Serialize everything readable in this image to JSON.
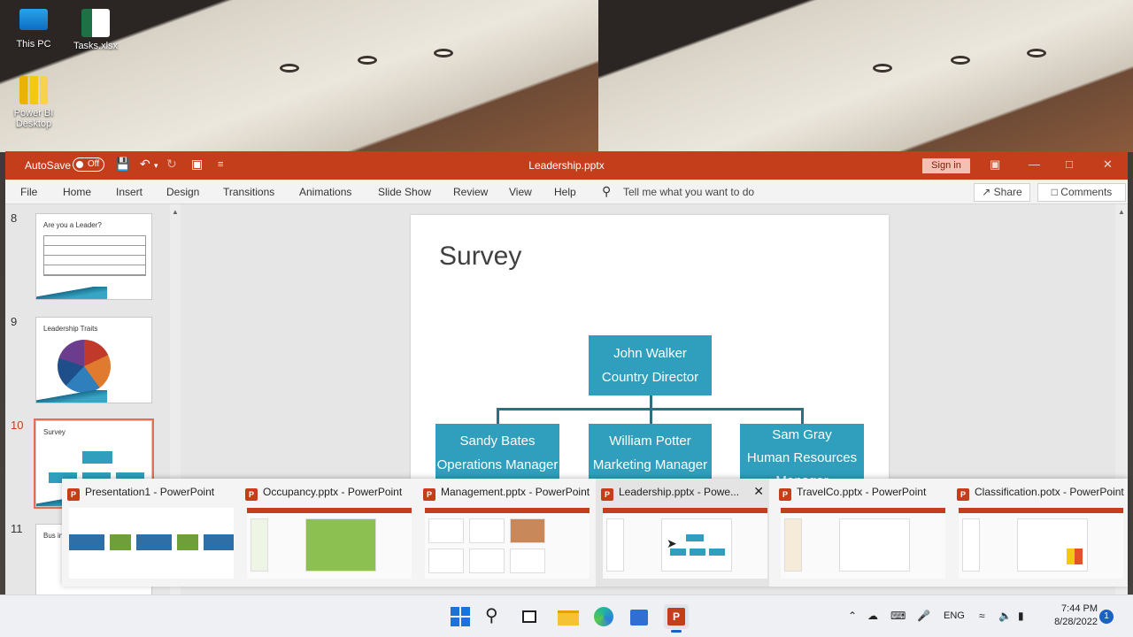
{
  "desktop": {
    "icons": [
      {
        "label": "This PC"
      },
      {
        "label": "Tasks.xlsx"
      },
      {
        "label": "Power BI Desktop"
      }
    ]
  },
  "window": {
    "title": "Leadership.pptx",
    "autosave_label": "AutoSave",
    "autosave_state": "Off",
    "signin_label": "Sign in",
    "accent": "#c43e1c"
  },
  "menu": {
    "tabs": [
      "File",
      "Home",
      "Insert",
      "Design",
      "Transitions",
      "Animations",
      "Slide Show",
      "Review",
      "View",
      "Help"
    ],
    "tell_me": "Tell me what you want to do",
    "share": "Share",
    "comments": "Comments"
  },
  "thumbnails": [
    {
      "number": "8",
      "title": "Are you a Leader?"
    },
    {
      "number": "9",
      "title": "Leadership Traits"
    },
    {
      "number": "10",
      "title": "Survey",
      "selected": true
    },
    {
      "number": "11",
      "title": "Bus ine"
    }
  ],
  "slide": {
    "title": "Survey",
    "org": {
      "top": {
        "name": "John Walker",
        "role": "Country Director"
      },
      "children": [
        {
          "name": "Sandy Bates",
          "role": "Operations Manager"
        },
        {
          "name": "William Potter",
          "role": "Marketing Manager"
        },
        {
          "name": "Sam Gray",
          "role": "Human Resources Manager"
        }
      ],
      "box_color": "#2f9fbd"
    }
  },
  "flyout": [
    {
      "title": "Presentation1 - PowerPoint"
    },
    {
      "title": "Occupancy.pptx - PowerPoint"
    },
    {
      "title": "Management.pptx - PowerPoint"
    },
    {
      "title": "Leadership.pptx - Powe...",
      "active": true
    },
    {
      "title": "TravelCo.pptx - PowerPoint"
    },
    {
      "title": "Classification.potx - PowerPoint"
    }
  ],
  "taskbar": {
    "language": "ENG",
    "time": "7:44 PM",
    "date": "8/28/2022",
    "notifications": "1"
  }
}
